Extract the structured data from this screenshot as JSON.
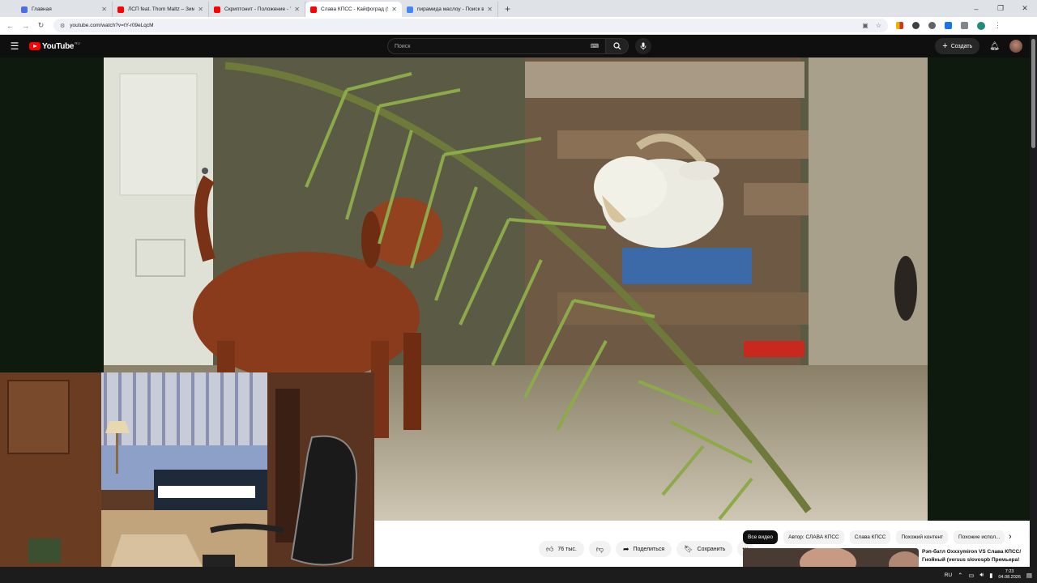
{
  "browser": {
    "tabs": [
      {
        "title": "Главная",
        "favicon_color": "#4a6fe0",
        "active": false
      },
      {
        "title": "ЛСП feat. Thom Maltz – Зима...",
        "favicon_color": "#ff0000",
        "active": false
      },
      {
        "title": "Скриптонит - Положение - Yo...",
        "favicon_color": "#ff0000",
        "active": false
      },
      {
        "title": "Слава КПСС - Кайфоград (Sun...",
        "favicon_color": "#ff0000",
        "active": true
      },
      {
        "title": "пирамида маслоу - Поиск в G...",
        "favicon_color": "#4285f4",
        "active": false
      }
    ],
    "new_tab_icon": "+",
    "address": "youtube.com/watch?v=tY-r09eLqcM",
    "window_controls": {
      "minimize": "–",
      "maximize": "❐",
      "close": "✕"
    }
  },
  "youtube": {
    "logo_text": "YouTube",
    "region": "RU",
    "search_placeholder": "Поиск",
    "create_label": "Создать",
    "actions": {
      "likes": "76 тыс.",
      "share": "Поделиться",
      "save": "Сохранить",
      "more": "•••"
    },
    "chips": [
      "Все видео",
      "Автор: СЛАВА КПСС",
      "Слава КПСС",
      "Похожий контент",
      "Похожие испол..."
    ],
    "recommendation": {
      "title": "Рэп-батл Oxxxymiron VS Слава КПСС/Гнойный (versus slovospb Премьера!"
    }
  },
  "taskbar": {
    "language": "RU",
    "time": "7:23",
    "date": "04.08.2026"
  },
  "colors": {
    "youtube_red": "#ff0000",
    "masthead_bg": "#0f0f0f",
    "player_side_bg": "#0d1a0d"
  }
}
